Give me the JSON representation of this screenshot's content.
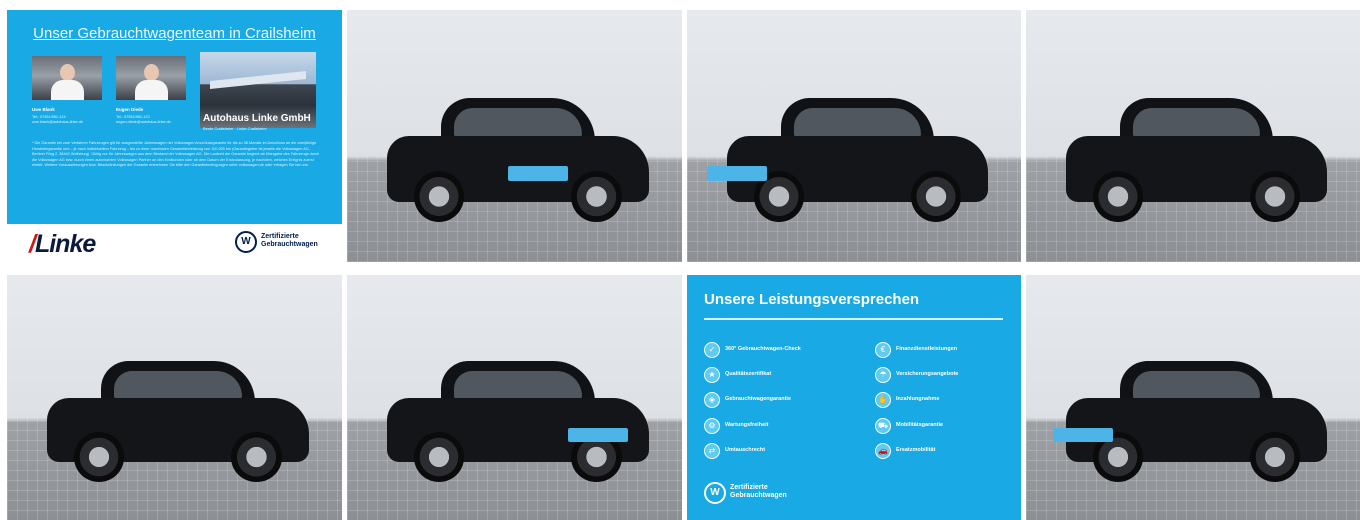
{
  "team_card": {
    "title": "Unser Gebrauchtwagenteam in Crailsheim",
    "people": [
      {
        "name": "Uwe Blank",
        "contact": [
          "Tel.: 07951/981-124",
          "uwe.blank@autohaus-linke.de"
        ]
      },
      {
        "name": "Eugen Diede",
        "contact": [
          "Tel.: 07951/981-123",
          "eugen.diede@autohaus-linke.de"
        ]
      }
    ],
    "building_label": "Autohaus Linke GmbH",
    "building_subtitle": "Beste Crailsheim · Linke-Crailsheim",
    "disclaimer": "* Die Garantie bei zum Verfahren Fahrzeugen gilt für ausgewählte Jahreswagen der Volkswagen Anschlussgarantie für bis zu 36 Monate im Anschluss an die zweijährige Herstellergarantie und – je nach individuellem Fahrzeug – bis zu einer maximalen Gesamtfahrleistung von 100.000 km (Garantiegeber ist jeweils die Volkswagen AG, Berliner Ring 2, 38440 Wolfsburg). Gültig nur für Jahreswagen aus dem Bestand der Volkswagen AG. Die Laufzeit der Garantie beginnt ab Übergabe des Fahrzeugs durch die Volkswagen AG bzw. durch einen autorisierten Volkswagen Partner an den Endkunden oder ab dem Datum der Erstzulassung, je nachdem, welches Ereignis zuerst eintritt. Weitere Voraussetzungen bzw. Beschränkungen der Garantie entnehmen Sie bitte den Garantiebedingungen unter volkswagen.de oder erfragen Sie bei uns.",
    "dealer_logo": "Linke",
    "vw_label": [
      "Zertifizierte",
      "Gebrauchtwagen"
    ]
  },
  "services_card": {
    "title": "Unsere Leistungsversprechen",
    "left_items": [
      "360° Gebrauchtwagen-Check",
      "Qualitätszertifikat",
      "Gebrauchtwagengarantie",
      "Wartungsfreiheit",
      "Umtauschrecht"
    ],
    "right_items": [
      "Finanzdienstleistungen",
      "Versicherungsangebote",
      "Inzahlungnahme",
      "Mobilitätsgarantie",
      "Ersatzmobilität"
    ],
    "vw_label": [
      "Zertifizierte",
      "Gebrauchtwagen"
    ]
  },
  "icons": [
    "person-photo-icon",
    "building-photo-icon",
    "car-photo-icon",
    "check-circle-icon",
    "certificate-icon",
    "shield-icon",
    "service-icon",
    "exchange-icon",
    "finance-icon",
    "insurance-icon",
    "hand-car-icon",
    "mobility-icon",
    "replacement-car-icon",
    "vw-logo-icon"
  ],
  "colors": {
    "brand_blue": "#19a9e4",
    "vw_navy": "#001e50",
    "linke_red": "#d5131a"
  }
}
